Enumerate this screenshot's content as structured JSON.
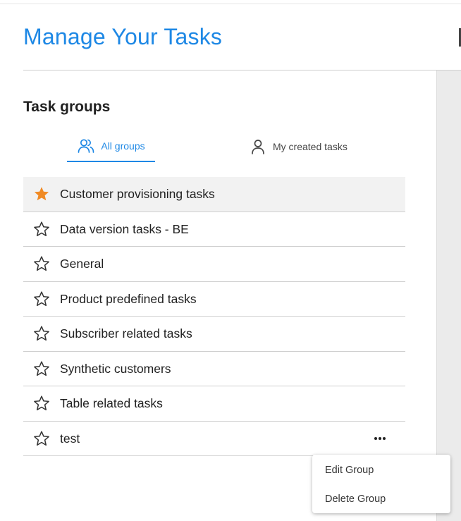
{
  "header": {
    "title": "Manage Your Tasks"
  },
  "section": {
    "title": "Task groups"
  },
  "tabs": [
    {
      "label": "All groups",
      "icon": "users-icon",
      "active": true
    },
    {
      "label": "My created tasks",
      "icon": "user-icon",
      "active": false
    }
  ],
  "groups": [
    {
      "name": "Customer provisioning tasks",
      "starred": true,
      "selected": true
    },
    {
      "name": "Data version tasks - BE",
      "starred": false
    },
    {
      "name": "General",
      "starred": false
    },
    {
      "name": "Product predefined tasks",
      "starred": false
    },
    {
      "name": "Subscriber related tasks",
      "starred": false
    },
    {
      "name": "Synthetic customers",
      "starred": false
    },
    {
      "name": "Table related tasks",
      "starred": false
    },
    {
      "name": "test",
      "starred": false,
      "has_menu": true
    }
  ],
  "context_menu": {
    "items": [
      {
        "label": "Edit Group"
      },
      {
        "label": "Delete Group"
      }
    ]
  },
  "colors": {
    "accent": "#1e88e5",
    "star_filled": "#f08a24"
  }
}
